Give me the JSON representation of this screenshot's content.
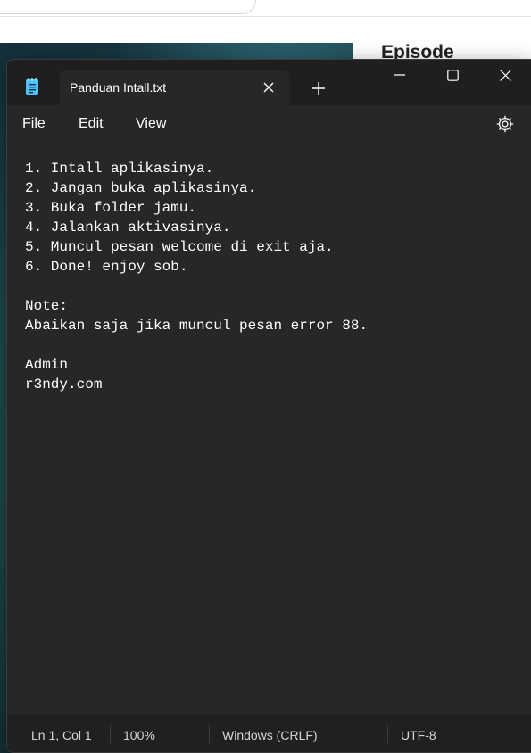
{
  "background": {
    "heading": "Episode"
  },
  "window": {
    "app_icon": "notepad-icon",
    "tab": {
      "title": "Panduan Intall.txt",
      "close_icon": "close-icon"
    },
    "new_tab_icon": "plus-icon",
    "controls": {
      "minimize_icon": "minimize-icon",
      "maximize_icon": "maximize-icon",
      "close_icon": "close-icon"
    }
  },
  "menu": {
    "file": "File",
    "edit": "Edit",
    "view": "View",
    "settings_icon": "gear-icon"
  },
  "editor": {
    "lines": [
      "1. Intall aplikasinya.",
      "2. Jangan buka aplikasinya.",
      "3. Buka folder jamu.",
      "4. Jalankan aktivasinya.",
      "5. Muncul pesan welcome di exit aja.",
      "6. Done! enjoy sob.",
      "",
      "Note:",
      "Abaikan saja jika muncul pesan error 88.",
      "",
      "Admin",
      "r3ndy.com"
    ]
  },
  "status": {
    "position": "Ln 1, Col 1",
    "zoom": "100%",
    "line_ending": "Windows (CRLF)",
    "encoding": "UTF-8"
  },
  "colors": {
    "window_bg": "#272727",
    "titlebar_bg": "#1f1f1f",
    "text": "#ffffff",
    "accent_icon": "#4cc2ff"
  }
}
